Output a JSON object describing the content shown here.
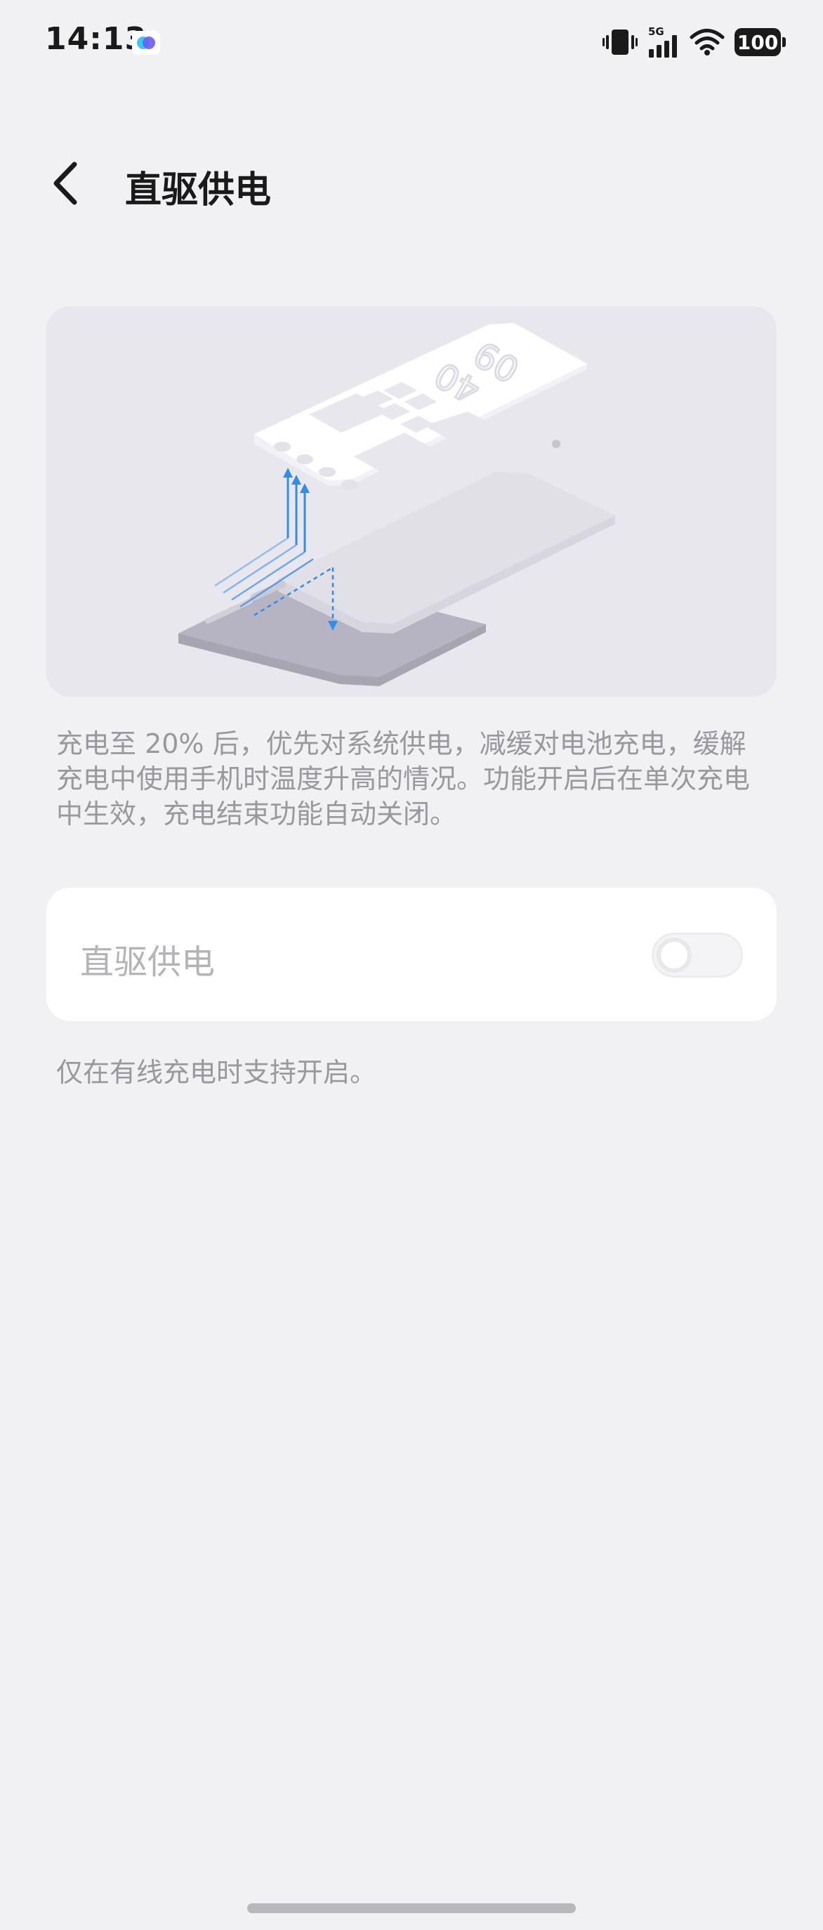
{
  "status_bar": {
    "time": "14:13",
    "network": "5G",
    "battery": "100"
  },
  "header": {
    "title": "直驱供电"
  },
  "illustration": {
    "clock_top": "09",
    "clock_bottom": "40"
  },
  "description": "充电至 20% 后，优先对系统供电，减缓对电池充电，缓解充电中使用手机时温度升高的情况。功能开启后在单次充电中生效，充电结束功能自动关闭。",
  "toggle": {
    "label": "直驱供电",
    "enabled": false
  },
  "hint": "仅在有线充电时支持开启。",
  "colors": {
    "background": "#f1f1f4",
    "card": "#ffffff",
    "illustration_bg": "#e8e7ed",
    "arrow_blue": "#2f8fe8",
    "secondary_text": "#98989d"
  }
}
